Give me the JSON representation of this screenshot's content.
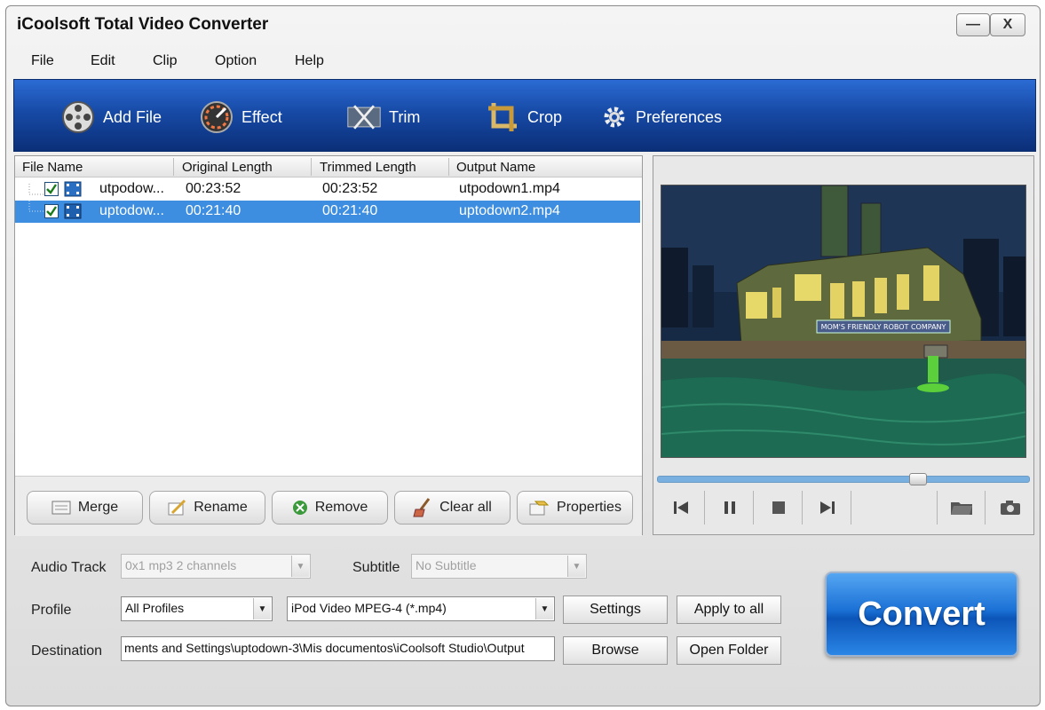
{
  "window": {
    "title": "iCoolsoft Total Video Converter",
    "minimize_label": "—",
    "close_label": "X"
  },
  "menu": [
    "File",
    "Edit",
    "Clip",
    "Option",
    "Help"
  ],
  "toolbar": {
    "add_file": "Add File",
    "effect": "Effect",
    "trim": "Trim",
    "crop": "Crop",
    "preferences": "Preferences"
  },
  "file_list": {
    "headers": [
      "File Name",
      "Original Length",
      "Trimmed Length",
      "Output Name"
    ],
    "rows": [
      {
        "name": "utpodow...",
        "original": "00:23:52",
        "trimmed": "00:23:52",
        "output": "utpodown1.mp4",
        "checked": true,
        "selected": false
      },
      {
        "name": "uptodow...",
        "original": "00:21:40",
        "trimmed": "00:21:40",
        "output": "uptodown2.mp4",
        "checked": true,
        "selected": true
      }
    ]
  },
  "list_buttons": {
    "merge": "Merge",
    "rename": "Rename",
    "remove": "Remove",
    "clear_all": "Clear all",
    "properties": "Properties"
  },
  "preview": {
    "sign_text": "MOM'S FRIENDLY ROBOT COMPANY",
    "seek_position": 0.71
  },
  "settings": {
    "audio_track_label": "Audio Track",
    "audio_track_value": "0x1 mp3 2 channels",
    "subtitle_label": "Subtitle",
    "subtitle_value": "No Subtitle",
    "profile_label": "Profile",
    "profile_category": "All Profiles",
    "profile_value": "iPod Video MPEG-4 (*.mp4)",
    "settings_button": "Settings",
    "apply_all_button": "Apply to all",
    "destination_label": "Destination",
    "destination_value": "ments and Settings\\uptodown-3\\Mis documentos\\iCoolsoft Studio\\Output",
    "browse_button": "Browse",
    "open_folder_button": "Open Folder"
  },
  "convert_button": "Convert",
  "colors": {
    "toolbar_blue": "#174aa6",
    "selection_blue": "#3d8ee0",
    "convert_blue": "#1b71d6"
  }
}
